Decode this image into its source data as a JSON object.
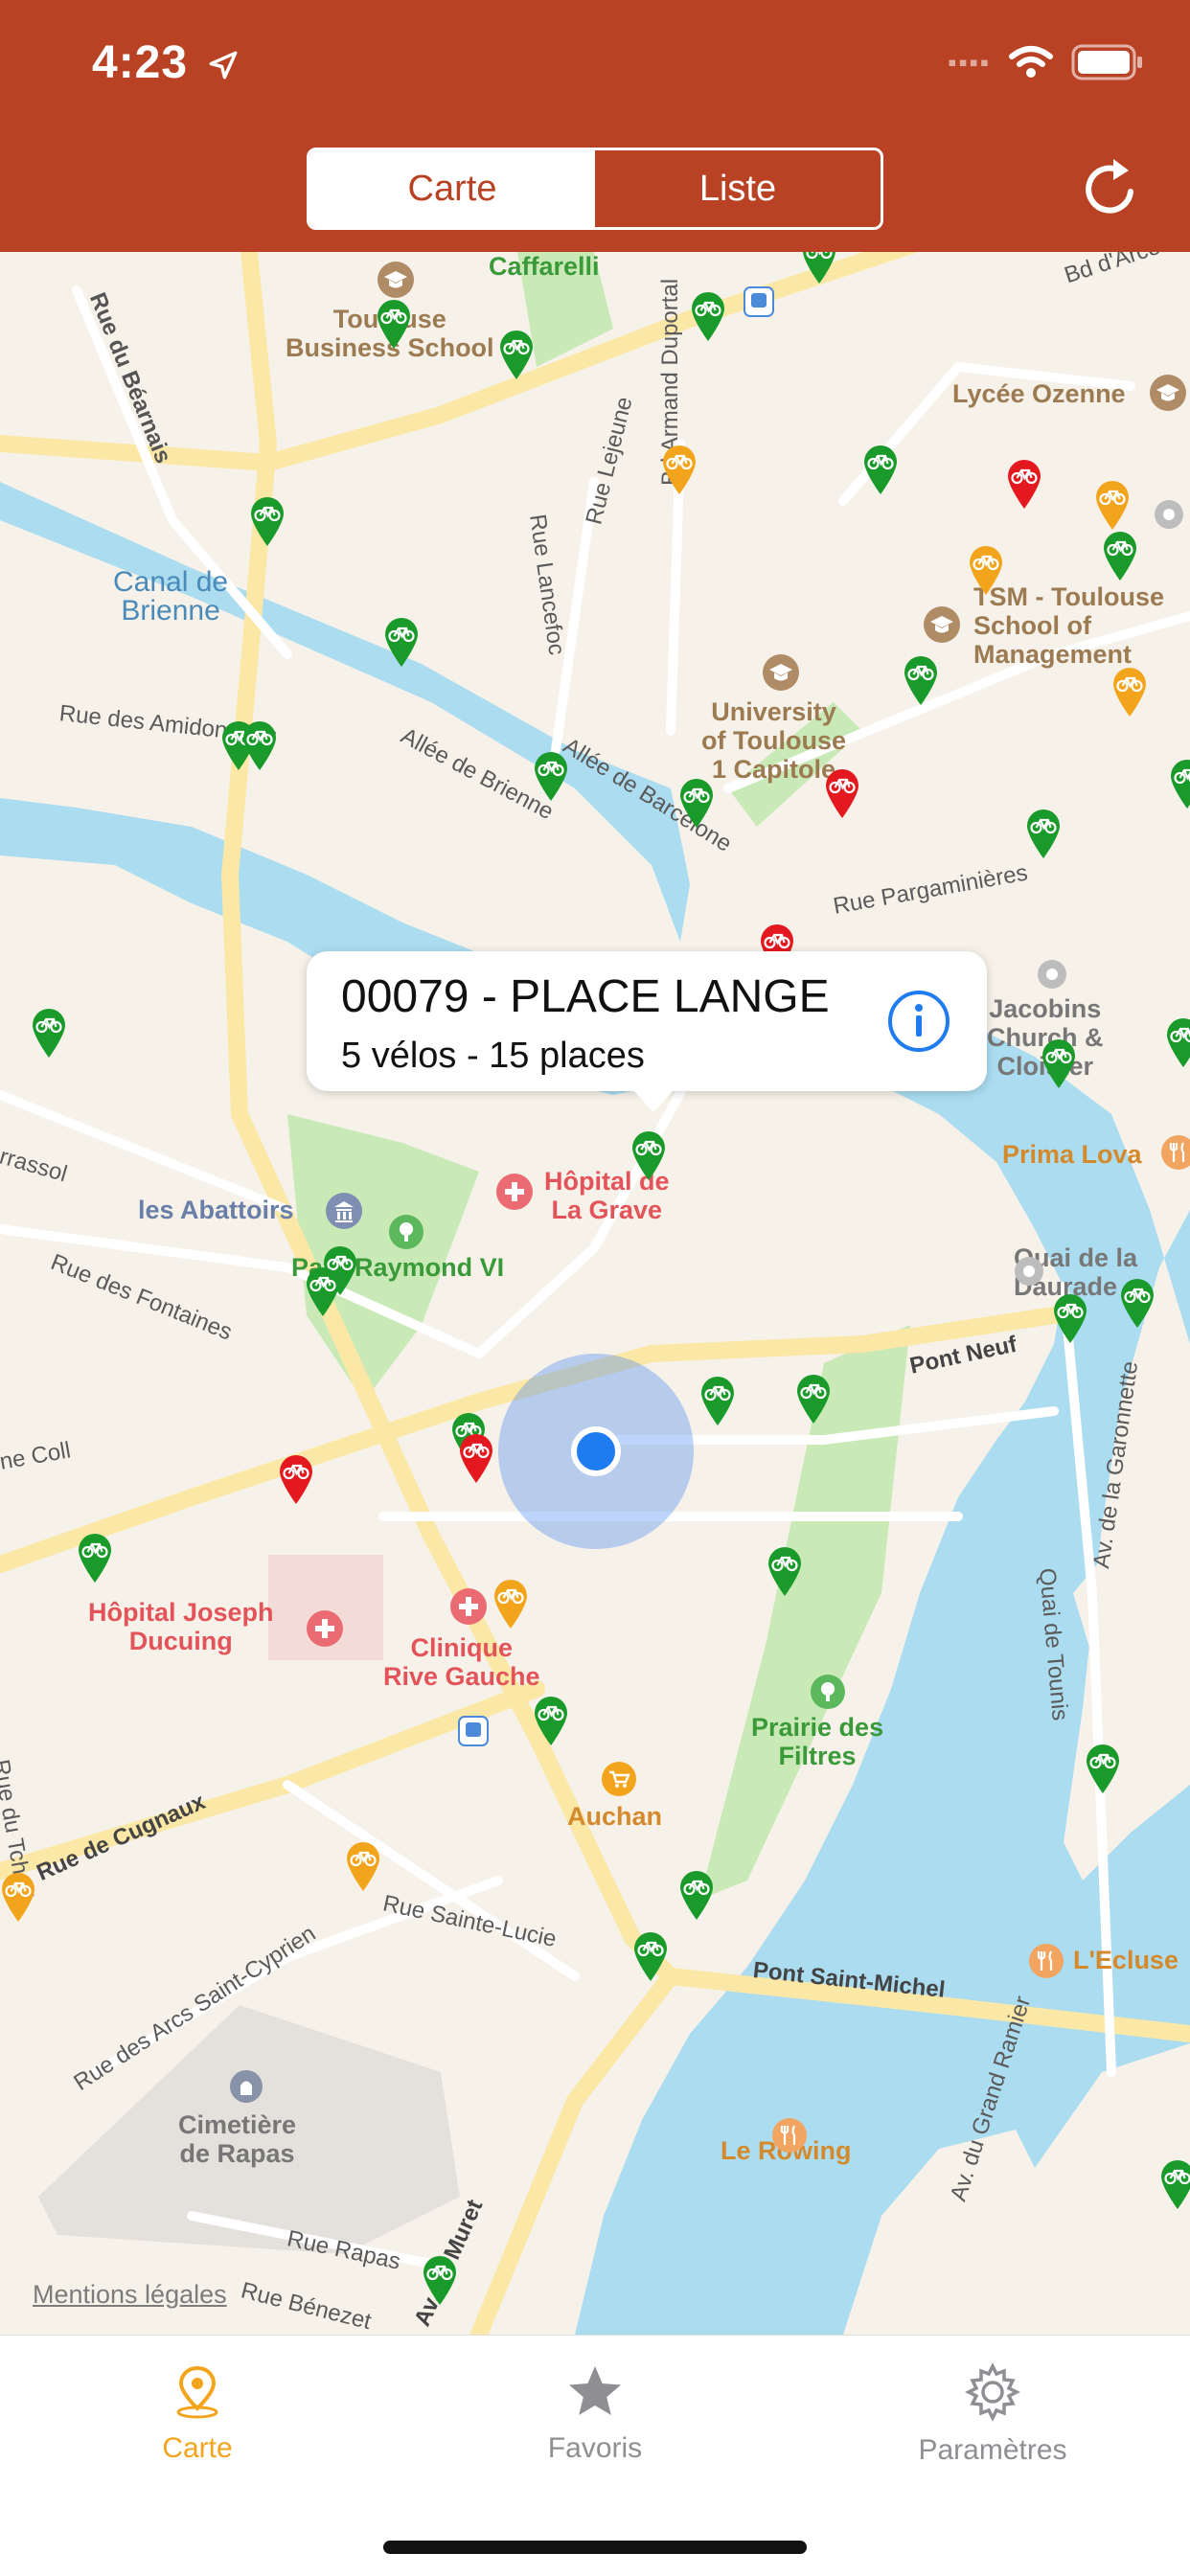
{
  "status": {
    "time": "4:23"
  },
  "header": {
    "segments": [
      {
        "label": "Carte",
        "active": true
      },
      {
        "label": "Liste",
        "active": false
      }
    ],
    "refresh_icon": "refresh-icon"
  },
  "map": {
    "places": {
      "caffarelli": "Caffarelli",
      "toulouse_bs": "Toulouse\nBusiness School",
      "lycee_ozenne": "Lycée Ozenne",
      "tsm": "TSM - Toulouse\nSchool of\nManagement",
      "canal": "Canal de\nBrienne",
      "univ": "University\nof Toulouse\n1 Capitole",
      "jacobins": "Jacobins\nChurch &\nCloister",
      "prima_lova": "Prima Lova",
      "hopital_grave": "Hôpital de\nLa Grave",
      "abattoirs": "les Abattoirs",
      "parc": "Parc Raymond VI",
      "quai_daurade": "Quai de la\nDaurade",
      "hopital_ducuing": "Hôpital Joseph\nDucuing",
      "clinique": "Clinique\nRive Gauche",
      "prairie": "Prairie des\nFiltres",
      "auchan": "Auchan",
      "lecluse": "L'Ecluse",
      "cimetiere": "Cimetière\nde Rapas",
      "rowing": "Le Rowing"
    },
    "streets": {
      "bearnais": "Rue du Béarnais",
      "lancefoc": "Rue Lancefoc",
      "lejeune": "Rue Lejeune",
      "armand": "Bd Armand Duportal",
      "amidonniers": "Rue des Amidonniers",
      "brienne": "Allée de Brienne",
      "barcelone": "Allée de Barcelone",
      "pargaminieres": "Rue Pargaminières",
      "fontaines": "Rue des Fontaines",
      "pont_neuf": "Pont Neuf",
      "tounis": "Quai de Tounis",
      "garonnette": "Av. de la Garonnette",
      "cugnaux": "Rue de Cugnaux",
      "arcs": "Rue des Arcs Saint-Cyprien",
      "sainte_lucie": "Rue Sainte-Lucie",
      "pont_st_michel": "Pont Saint-Michel",
      "grand_ramier": "Av. du Grand Ramier",
      "rapas": "Rue Rapas",
      "benezet": "Rue Bénezet",
      "muret": "Av. de Muret",
      "tchad": "Rue du Tchad",
      "coll": "ne Coll",
      "rassol": "rrassol",
      "arcole": "Bd d'Arcole"
    },
    "callout": {
      "title": "00079 - PLACE LANGE",
      "subtitle": "5 vélos - 15 places",
      "info_icon": "info-icon"
    },
    "legal": "Mentions légales",
    "colors": {
      "green": "#1a9a2a",
      "orange": "#f2a51c",
      "red": "#e3191f",
      "water": "#abdcf0",
      "park": "#c9e9b6"
    }
  },
  "tabbar": {
    "tabs": [
      {
        "label": "Carte",
        "icon": "map-pin-icon",
        "active": true
      },
      {
        "label": "Favoris",
        "icon": "star-icon",
        "active": false
      },
      {
        "label": "Paramètres",
        "icon": "gear-icon",
        "active": false
      }
    ]
  }
}
